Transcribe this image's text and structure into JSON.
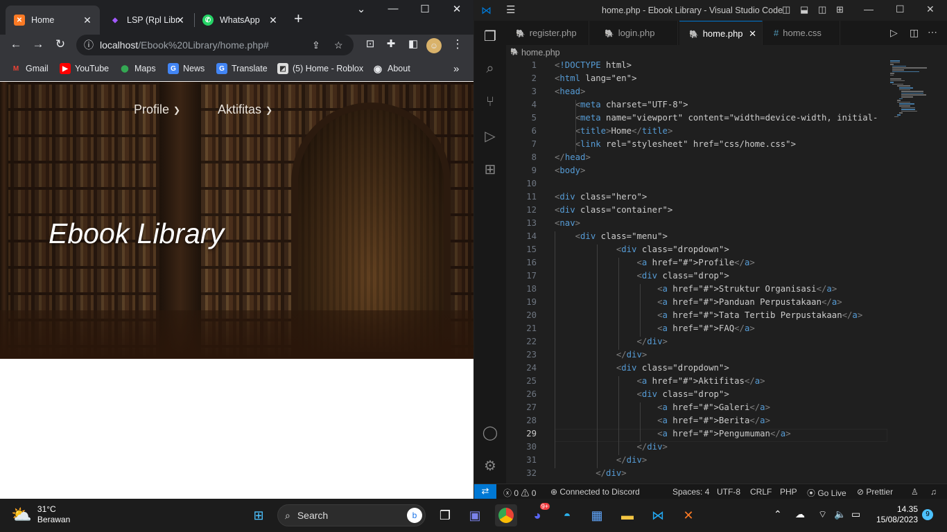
{
  "browser": {
    "tabs": [
      {
        "title": "Home",
        "icon": "xampp-icon",
        "color": "#fb7a24"
      },
      {
        "title": "LSP (Rpl Libra",
        "icon": "figma-icon",
        "color": "#a259ff"
      },
      {
        "title": "WhatsApp",
        "icon": "whatsapp-icon",
        "color": "#25d366"
      }
    ],
    "address": {
      "host": "localhost",
      "path": "/Ebook%20Library/home.php#"
    },
    "bookmarks": [
      "Gmail",
      "YouTube",
      "Maps",
      "News",
      "Translate",
      "(5) Home - Roblox",
      "About"
    ]
  },
  "page": {
    "nav": [
      "Profile",
      "Aktifitas"
    ],
    "hero_title": "Ebook Library"
  },
  "vscode": {
    "title": "home.php - Ebook Library - Visual Studio Code",
    "tabs": [
      "register.php",
      "login.php",
      "home.php",
      "home.css"
    ],
    "breadcrumb": "home.php",
    "line_numbers": [
      "1",
      "2",
      "3",
      "4",
      "5",
      "6",
      "7",
      "8",
      "9",
      "10",
      "11",
      "12",
      "13",
      "14",
      "15",
      "16",
      "17",
      "18",
      "19",
      "20",
      "21",
      "22",
      "23",
      "24",
      "25",
      "26",
      "27",
      "28",
      "29",
      "30",
      "31",
      "32"
    ],
    "current_line": "29",
    "code_lines": [
      "<!DOCTYPE html>",
      "<html lang=\"en\">",
      "<head>",
      "    <meta charset=\"UTF-8\">",
      "    <meta name=\"viewport\" content=\"width=device-width, initial-",
      "    <title>Home</title>",
      "    <link rel=\"stylesheet\" href=\"css/home.css\">",
      "</head>",
      "<body>",
      "",
      "<div class=\"hero\">",
      "<div class=\"container\">",
      "<nav>",
      "    <div class=\"menu\">",
      "            <div class=\"dropdown\">",
      "                <a href=\"#\">Profile</a>",
      "                <div class=\"drop\">",
      "                    <a href=\"#\">Struktur Organisasi</a>",
      "                    <a href=\"#\">Panduan Perpustakaan</a>",
      "                    <a href=\"#\">Tata Tertib Perpustakaan</a>",
      "                    <a href=\"#\">FAQ</a>",
      "                </div>",
      "            </div>",
      "            <div class=\"dropdown\">",
      "                <a href=\"#\">Aktifitas</a>",
      "                <div class=\"drop\">",
      "                    <a href=\"#\">Galeri</a>",
      "                    <a href=\"#\">Berita</a>",
      "                    <a href=\"#\">Pengumuman</a>",
      "                </div>",
      "            </div>",
      "        </div>"
    ],
    "status": {
      "errors": "0",
      "warnings": "0",
      "discord": "Connected to Discord",
      "spaces": "Spaces: 4",
      "encoding": "UTF-8",
      "eol": "CRLF",
      "language": "PHP",
      "golive": "Go Live",
      "prettier": "Prettier"
    }
  },
  "taskbar": {
    "temp": "31°C",
    "weather": "Berawan",
    "search": "Search",
    "time": "14.35",
    "date": "15/08/2023",
    "notif": "9",
    "discord_badge": "9+"
  }
}
